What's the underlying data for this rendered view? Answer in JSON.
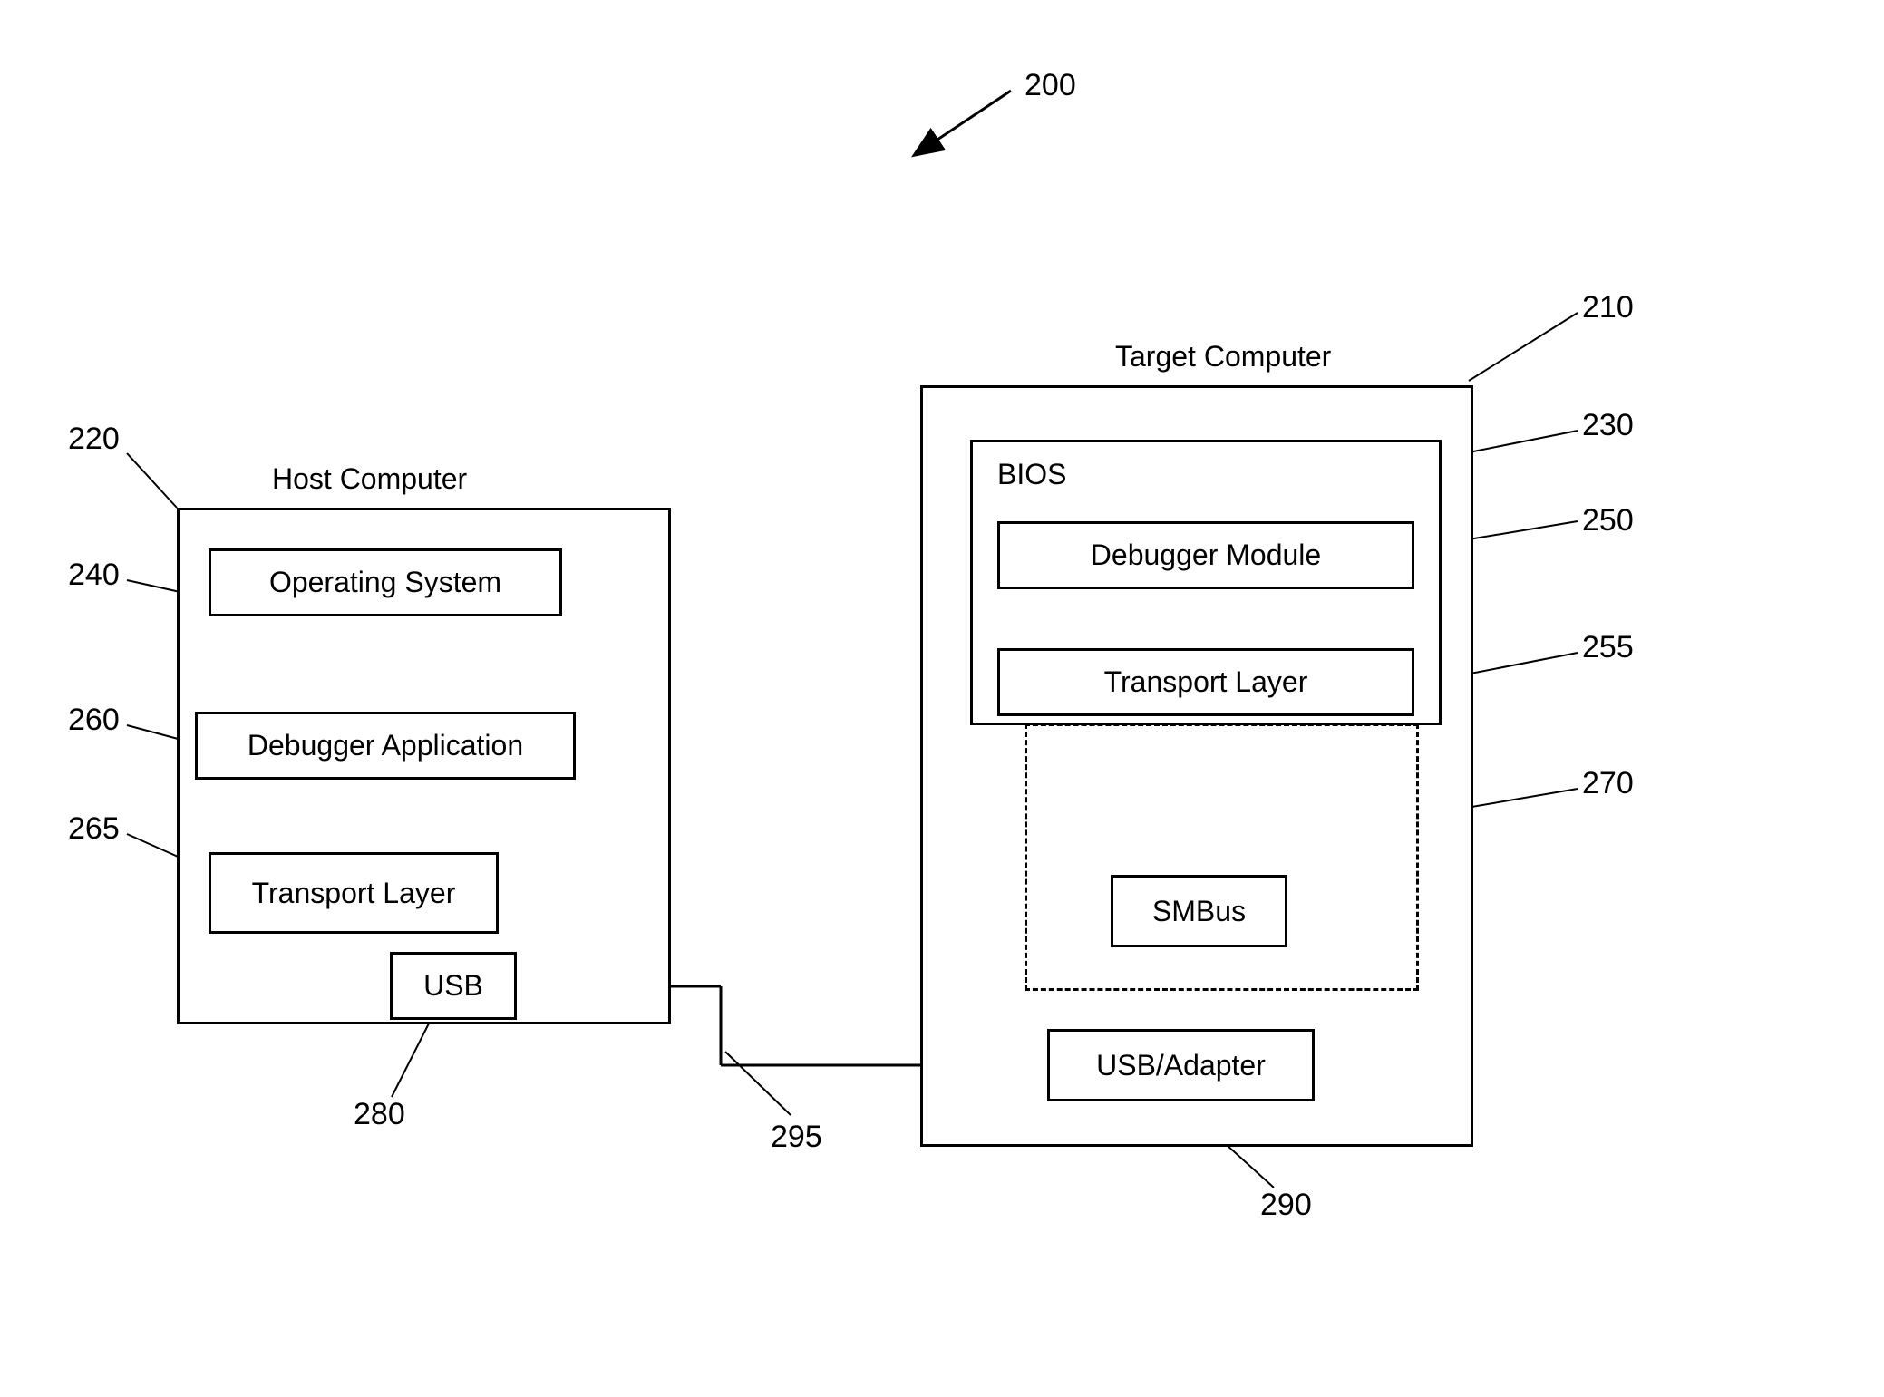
{
  "diagram_ref": "200",
  "host": {
    "title": "Host Computer",
    "ref": "220",
    "components": {
      "os": {
        "label": "Operating System",
        "ref": "240"
      },
      "debugger": {
        "label": "Debugger Application",
        "ref": "260"
      },
      "transport": {
        "label": "Transport Layer",
        "ref": "265"
      },
      "usb": {
        "label": "USB",
        "ref": "280"
      }
    }
  },
  "target": {
    "title": "Target Computer",
    "ref": "210",
    "bios": {
      "label": "BIOS",
      "ref": "230",
      "components": {
        "debugger_module": {
          "label": "Debugger Module",
          "ref": "250"
        },
        "transport": {
          "label": "Transport Layer",
          "ref": "255"
        }
      }
    },
    "smbus": {
      "label": "SMBus",
      "dashed_ref": "270"
    },
    "usb_adapter": {
      "label": "USB/Adapter",
      "ref": "290"
    }
  },
  "connection_ref": "295"
}
